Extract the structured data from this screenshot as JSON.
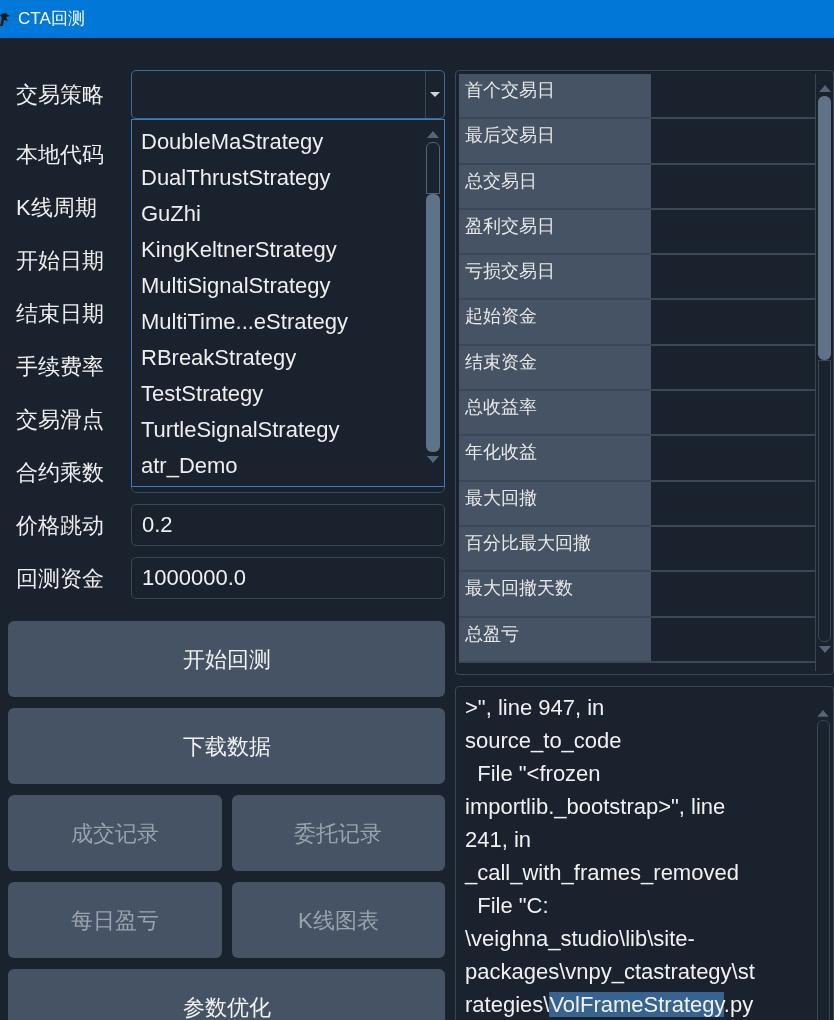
{
  "window": {
    "title": "CTA回测"
  },
  "form": {
    "fields": [
      {
        "label": "交易策略",
        "kind": "combo"
      },
      {
        "label": "本地代码",
        "kind": "covered"
      },
      {
        "label": "K线周期",
        "kind": "covered"
      },
      {
        "label": "开始日期",
        "kind": "covered"
      },
      {
        "label": "结束日期",
        "kind": "covered"
      },
      {
        "label": "手续费率",
        "kind": "covered"
      },
      {
        "label": "交易滑点",
        "kind": "covered"
      },
      {
        "label": "合约乘数",
        "kind": "text"
      },
      {
        "label": "价格跳动",
        "kind": "text",
        "value": "0.2"
      },
      {
        "label": "回测资金",
        "kind": "text",
        "value": "1000000.0"
      }
    ]
  },
  "dropdown": {
    "items": [
      "DoubleMaStrategy",
      "DualThrustStrategy",
      "GuZhi",
      "KingKeltnerStrategy",
      "MultiSignalStrategy",
      "MultiTime...eStrategy",
      "RBreakStrategy",
      "TestStrategy",
      "TurtleSignalStrategy",
      "atr_Demo"
    ]
  },
  "buttons": [
    {
      "label": "开始回测",
      "disabled": false,
      "kind": "wide"
    },
    {
      "label": "下载数据",
      "disabled": false,
      "kind": "wide"
    },
    {
      "label": "成交记录",
      "disabled": true,
      "kind": "half"
    },
    {
      "label": "委托记录",
      "disabled": true,
      "kind": "half"
    },
    {
      "label": "每日盈亏",
      "disabled": true,
      "kind": "half"
    },
    {
      "label": "K线图表",
      "disabled": true,
      "kind": "half"
    },
    {
      "label": "参数优化",
      "disabled": false,
      "kind": "wide"
    }
  ],
  "statistics": {
    "rows": [
      "首个交易日",
      "最后交易日",
      "总交易日",
      "盈利交易日",
      "亏损交易日",
      "起始资金",
      "结束资金",
      "总收益率",
      "年化收益",
      "最大回撤",
      "百分比最大回撤",
      "最大回撤天数",
      "总盈亏"
    ]
  },
  "log": {
    "lines": [
      {
        "segments": [
          {
            "text": ">\", line 947, in",
            "selected": false
          }
        ]
      },
      {
        "segments": [
          {
            "text": "source_to_code",
            "selected": false
          }
        ]
      },
      {
        "segments": [
          {
            "text": "  File \"<frozen",
            "selected": false
          }
        ]
      },
      {
        "segments": [
          {
            "text": "importlib._bootstrap>\", line",
            "selected": false
          }
        ]
      },
      {
        "segments": [
          {
            "text": "241, in",
            "selected": false
          }
        ]
      },
      {
        "segments": [
          {
            "text": "_call_with_frames_removed",
            "selected": false
          }
        ]
      },
      {
        "segments": [
          {
            "text": "  File \"C:",
            "selected": false
          }
        ]
      },
      {
        "segments": [
          {
            "text": "\\veighna_studio\\lib\\site-",
            "selected": false
          }
        ]
      },
      {
        "segments": [
          {
            "text": "packages\\vnpy_ctastrategy\\st",
            "selected": false
          }
        ]
      },
      {
        "segments": [
          {
            "text": "rategies\\",
            "selected": false
          },
          {
            "text": "VolFrameStrategy",
            "selected": true
          },
          {
            "text": ".py",
            "selected": false
          }
        ]
      }
    ]
  }
}
